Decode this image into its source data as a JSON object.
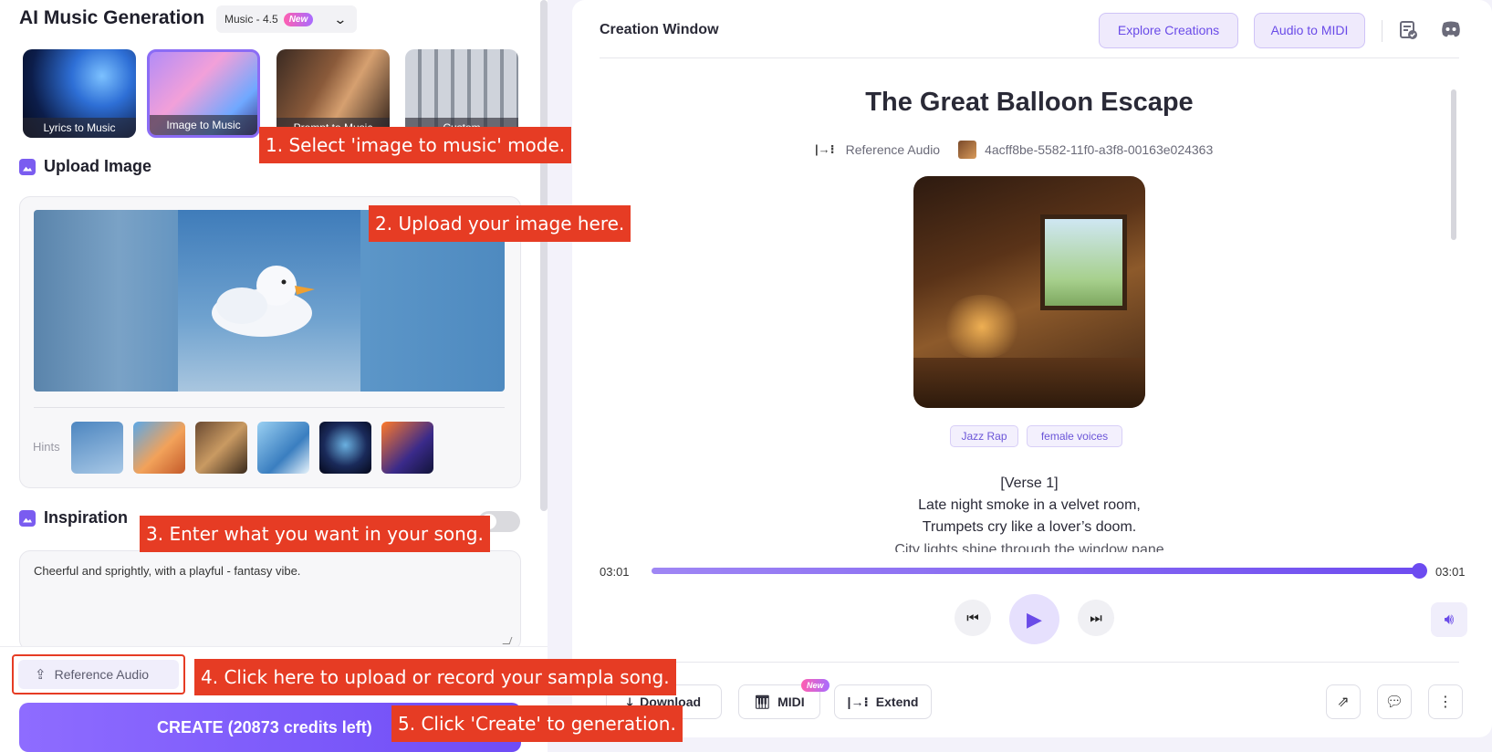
{
  "app": {
    "title": "AI Music Generation",
    "model_label": "Music - 4.5",
    "model_badge": "New"
  },
  "modes": [
    {
      "label": "Lyrics to Music",
      "selected": false
    },
    {
      "label": "Image to Music",
      "selected": true
    },
    {
      "label": "Prompt to Music",
      "selected": false
    },
    {
      "label": "Custom",
      "selected": false
    }
  ],
  "upload": {
    "heading": "Upload Image",
    "hints_label": "Hints"
  },
  "inspiration": {
    "heading": "Inspiration",
    "toggle_on": false,
    "value": "Cheerful and sprightly, with a playful - fantasy vibe."
  },
  "footer": {
    "reference_audio_label": "Reference Audio",
    "create_label": "CREATE (20873 credits left)"
  },
  "annotations": {
    "step1": "1. Select 'image to music' mode.",
    "step2": "2. Upload your image here.",
    "step3": "3. Enter what you want in your song.",
    "step4": "4. Click here to upload or record your sampla song.",
    "step5": "5. Click 'Create' to generation."
  },
  "creation": {
    "window_title": "Creation Window",
    "explore_label": "Explore Creations",
    "audio_to_midi_label": "Audio to MIDI",
    "song_title": "The Great Balloon Escape",
    "reference_label": "Reference Audio",
    "reference_id": "4acff8be-5582-11f0-a3f8-00163e024363",
    "tags": [
      "Jazz Rap",
      "female voices"
    ],
    "lyrics": [
      "[Verse 1]",
      "Late night smoke in a velvet room,",
      "Trumpets cry like a lover’s doom.",
      "City lights shine through the window pane"
    ],
    "time_current": "03:01",
    "time_total": "03:01",
    "progress": 1.0
  },
  "actions": {
    "download_label": "Download",
    "midi_label": "MIDI",
    "midi_badge": "New",
    "extend_label": "Extend"
  },
  "icons": {
    "task": "task-list-icon",
    "discord": "discord-icon",
    "share": "external-link-icon",
    "comment": "comment-icon",
    "more": "more-vertical-icon"
  },
  "colors": {
    "accent": "#6e4cf0",
    "annotation": "#e63c24"
  }
}
